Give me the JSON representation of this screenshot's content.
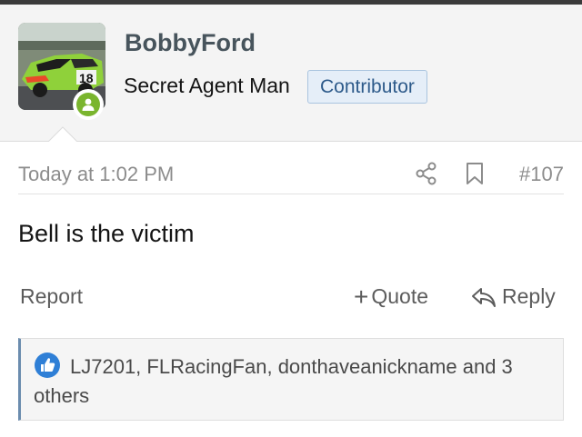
{
  "post": {
    "author": {
      "username": "BobbyFord",
      "title": "Secret Agent Man",
      "badge": "Contributor",
      "avatar_icon": "race-car-avatar",
      "online_icon": "user-online-icon"
    },
    "timestamp": "Today at 1:02 PM",
    "number": "#107",
    "body": "Bell is the victim",
    "actions": {
      "report": "Report",
      "quote": "Quote",
      "reply": "Reply"
    },
    "reactions": {
      "icon": "like-icon",
      "text": "LJ7201, FLRacingFan, donthaveanickname and 3 others"
    }
  },
  "colors": {
    "header_bg": "#f4f4f4",
    "username": "#47545c",
    "badge_bg": "#e5eef8",
    "badge_border": "#a9c4df",
    "online_green": "#7ab52e",
    "like_blue": "#2f7fd6",
    "reaction_accent": "#6b8cae"
  }
}
